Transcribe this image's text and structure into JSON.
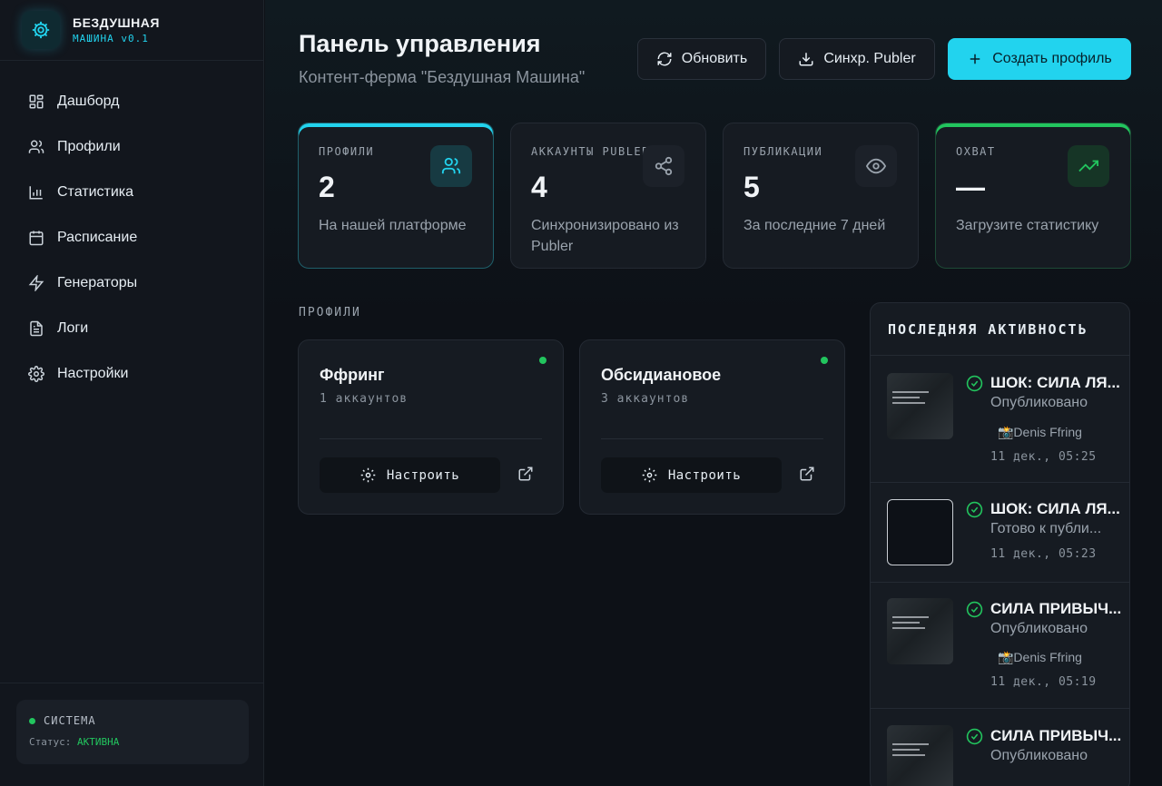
{
  "brand": {
    "name": "БЕЗДУШНАЯ",
    "version": "МАШИНА v0.1"
  },
  "nav": [
    {
      "label": "Дашборд",
      "icon": "dashboard-icon"
    },
    {
      "label": "Профили",
      "icon": "users-icon"
    },
    {
      "label": "Статистика",
      "icon": "bar-chart-icon"
    },
    {
      "label": "Расписание",
      "icon": "calendar-icon"
    },
    {
      "label": "Генераторы",
      "icon": "lightning-icon"
    },
    {
      "label": "Логи",
      "icon": "document-icon"
    },
    {
      "label": "Настройки",
      "icon": "gear-icon"
    }
  ],
  "system": {
    "label": "СИСТЕМА",
    "status_prefix": "Статус:",
    "status_value": "АКТИВНА"
  },
  "header": {
    "title": "Панель управления",
    "subtitle": "Контент-ферма \"Бездушная Машина\"",
    "refresh_label": "Обновить",
    "sync_label": "Синхр. Publer",
    "create_label": "Создать профиль"
  },
  "stats": [
    {
      "label": "ПРОФИЛИ",
      "value": "2",
      "desc": "На нашей платформе",
      "icon": "users-icon"
    },
    {
      "label": "АККАУНТЫ PUBLER",
      "value": "4",
      "desc": "Синхронизировано из Publer",
      "icon": "share-icon"
    },
    {
      "label": "ПУБЛИКАЦИИ",
      "value": "5",
      "desc": "За последние 7 дней",
      "icon": "eye-icon"
    },
    {
      "label": "ОХВАТ",
      "value": "—",
      "desc": "Загрузите статистику",
      "icon": "trending-up-icon"
    }
  ],
  "profiles_section": "ПРОФИЛИ",
  "profiles": [
    {
      "name": "Ффринг",
      "accounts": "1 аккаунтов",
      "configure_label": "Настроить"
    },
    {
      "name": "Обсидиановое",
      "accounts": "3 аккаунтов",
      "configure_label": "Настроить"
    }
  ],
  "activity": {
    "title": "ПОСЛЕДНЯЯ АКТИВНОСТЬ",
    "items": [
      {
        "title": "ШОК: СИЛА ЛЯ...",
        "status": "Опубликовано",
        "author": "📸Denis Ffring",
        "time": "11 дек., 05:25"
      },
      {
        "title": "ШОК: СИЛА ЛЯ...",
        "status": "Готово к публи...",
        "author": "",
        "time": "11 дек., 05:23"
      },
      {
        "title": "СИЛА ПРИВЫЧ...",
        "status": "Опубликовано",
        "author": "📸Denis Ffring",
        "time": "11 дек., 05:19"
      },
      {
        "title": "СИЛА ПРИВЫЧ...",
        "status": "Опубликовано",
        "author": "",
        "time": ""
      }
    ]
  },
  "colors": {
    "accent": "#22d3ee",
    "success": "#22c55e",
    "bg": "#0d1117"
  }
}
